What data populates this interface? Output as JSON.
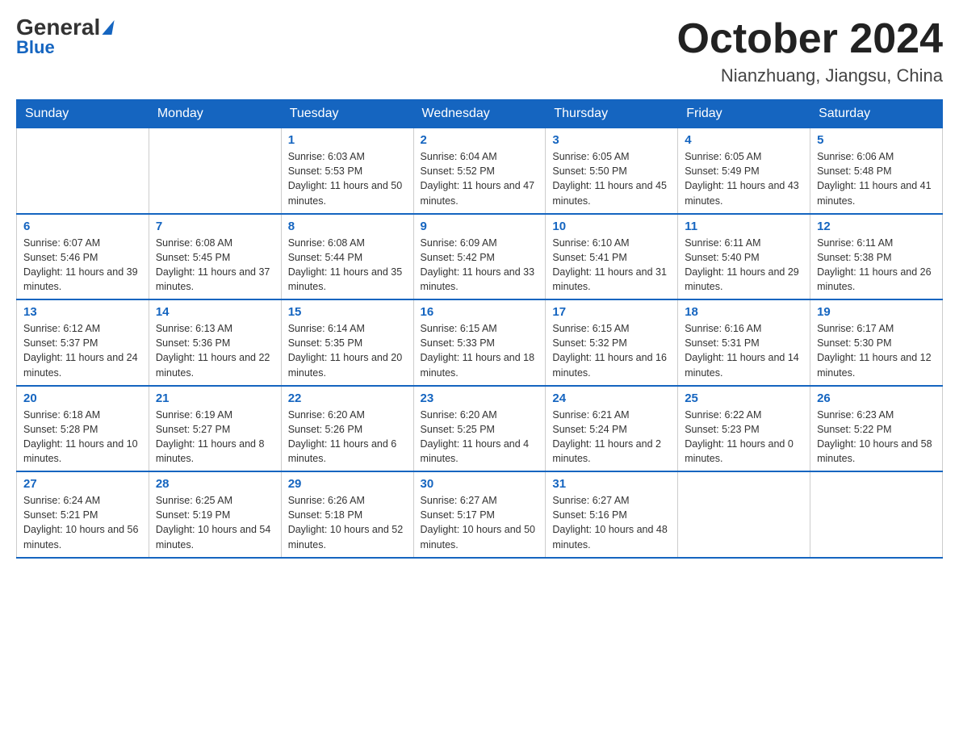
{
  "logo": {
    "general": "General",
    "blue": "Blue"
  },
  "title": "October 2024",
  "location": "Nianzhuang, Jiangsu, China",
  "days_of_week": [
    "Sunday",
    "Monday",
    "Tuesday",
    "Wednesday",
    "Thursday",
    "Friday",
    "Saturday"
  ],
  "weeks": [
    [
      {
        "day": "",
        "info": ""
      },
      {
        "day": "",
        "info": ""
      },
      {
        "day": "1",
        "info": "Sunrise: 6:03 AM\nSunset: 5:53 PM\nDaylight: 11 hours and 50 minutes."
      },
      {
        "day": "2",
        "info": "Sunrise: 6:04 AM\nSunset: 5:52 PM\nDaylight: 11 hours and 47 minutes."
      },
      {
        "day": "3",
        "info": "Sunrise: 6:05 AM\nSunset: 5:50 PM\nDaylight: 11 hours and 45 minutes."
      },
      {
        "day": "4",
        "info": "Sunrise: 6:05 AM\nSunset: 5:49 PM\nDaylight: 11 hours and 43 minutes."
      },
      {
        "day": "5",
        "info": "Sunrise: 6:06 AM\nSunset: 5:48 PM\nDaylight: 11 hours and 41 minutes."
      }
    ],
    [
      {
        "day": "6",
        "info": "Sunrise: 6:07 AM\nSunset: 5:46 PM\nDaylight: 11 hours and 39 minutes."
      },
      {
        "day": "7",
        "info": "Sunrise: 6:08 AM\nSunset: 5:45 PM\nDaylight: 11 hours and 37 minutes."
      },
      {
        "day": "8",
        "info": "Sunrise: 6:08 AM\nSunset: 5:44 PM\nDaylight: 11 hours and 35 minutes."
      },
      {
        "day": "9",
        "info": "Sunrise: 6:09 AM\nSunset: 5:42 PM\nDaylight: 11 hours and 33 minutes."
      },
      {
        "day": "10",
        "info": "Sunrise: 6:10 AM\nSunset: 5:41 PM\nDaylight: 11 hours and 31 minutes."
      },
      {
        "day": "11",
        "info": "Sunrise: 6:11 AM\nSunset: 5:40 PM\nDaylight: 11 hours and 29 minutes."
      },
      {
        "day": "12",
        "info": "Sunrise: 6:11 AM\nSunset: 5:38 PM\nDaylight: 11 hours and 26 minutes."
      }
    ],
    [
      {
        "day": "13",
        "info": "Sunrise: 6:12 AM\nSunset: 5:37 PM\nDaylight: 11 hours and 24 minutes."
      },
      {
        "day": "14",
        "info": "Sunrise: 6:13 AM\nSunset: 5:36 PM\nDaylight: 11 hours and 22 minutes."
      },
      {
        "day": "15",
        "info": "Sunrise: 6:14 AM\nSunset: 5:35 PM\nDaylight: 11 hours and 20 minutes."
      },
      {
        "day": "16",
        "info": "Sunrise: 6:15 AM\nSunset: 5:33 PM\nDaylight: 11 hours and 18 minutes."
      },
      {
        "day": "17",
        "info": "Sunrise: 6:15 AM\nSunset: 5:32 PM\nDaylight: 11 hours and 16 minutes."
      },
      {
        "day": "18",
        "info": "Sunrise: 6:16 AM\nSunset: 5:31 PM\nDaylight: 11 hours and 14 minutes."
      },
      {
        "day": "19",
        "info": "Sunrise: 6:17 AM\nSunset: 5:30 PM\nDaylight: 11 hours and 12 minutes."
      }
    ],
    [
      {
        "day": "20",
        "info": "Sunrise: 6:18 AM\nSunset: 5:28 PM\nDaylight: 11 hours and 10 minutes."
      },
      {
        "day": "21",
        "info": "Sunrise: 6:19 AM\nSunset: 5:27 PM\nDaylight: 11 hours and 8 minutes."
      },
      {
        "day": "22",
        "info": "Sunrise: 6:20 AM\nSunset: 5:26 PM\nDaylight: 11 hours and 6 minutes."
      },
      {
        "day": "23",
        "info": "Sunrise: 6:20 AM\nSunset: 5:25 PM\nDaylight: 11 hours and 4 minutes."
      },
      {
        "day": "24",
        "info": "Sunrise: 6:21 AM\nSunset: 5:24 PM\nDaylight: 11 hours and 2 minutes."
      },
      {
        "day": "25",
        "info": "Sunrise: 6:22 AM\nSunset: 5:23 PM\nDaylight: 11 hours and 0 minutes."
      },
      {
        "day": "26",
        "info": "Sunrise: 6:23 AM\nSunset: 5:22 PM\nDaylight: 10 hours and 58 minutes."
      }
    ],
    [
      {
        "day": "27",
        "info": "Sunrise: 6:24 AM\nSunset: 5:21 PM\nDaylight: 10 hours and 56 minutes."
      },
      {
        "day": "28",
        "info": "Sunrise: 6:25 AM\nSunset: 5:19 PM\nDaylight: 10 hours and 54 minutes."
      },
      {
        "day": "29",
        "info": "Sunrise: 6:26 AM\nSunset: 5:18 PM\nDaylight: 10 hours and 52 minutes."
      },
      {
        "day": "30",
        "info": "Sunrise: 6:27 AM\nSunset: 5:17 PM\nDaylight: 10 hours and 50 minutes."
      },
      {
        "day": "31",
        "info": "Sunrise: 6:27 AM\nSunset: 5:16 PM\nDaylight: 10 hours and 48 minutes."
      },
      {
        "day": "",
        "info": ""
      },
      {
        "day": "",
        "info": ""
      }
    ]
  ]
}
